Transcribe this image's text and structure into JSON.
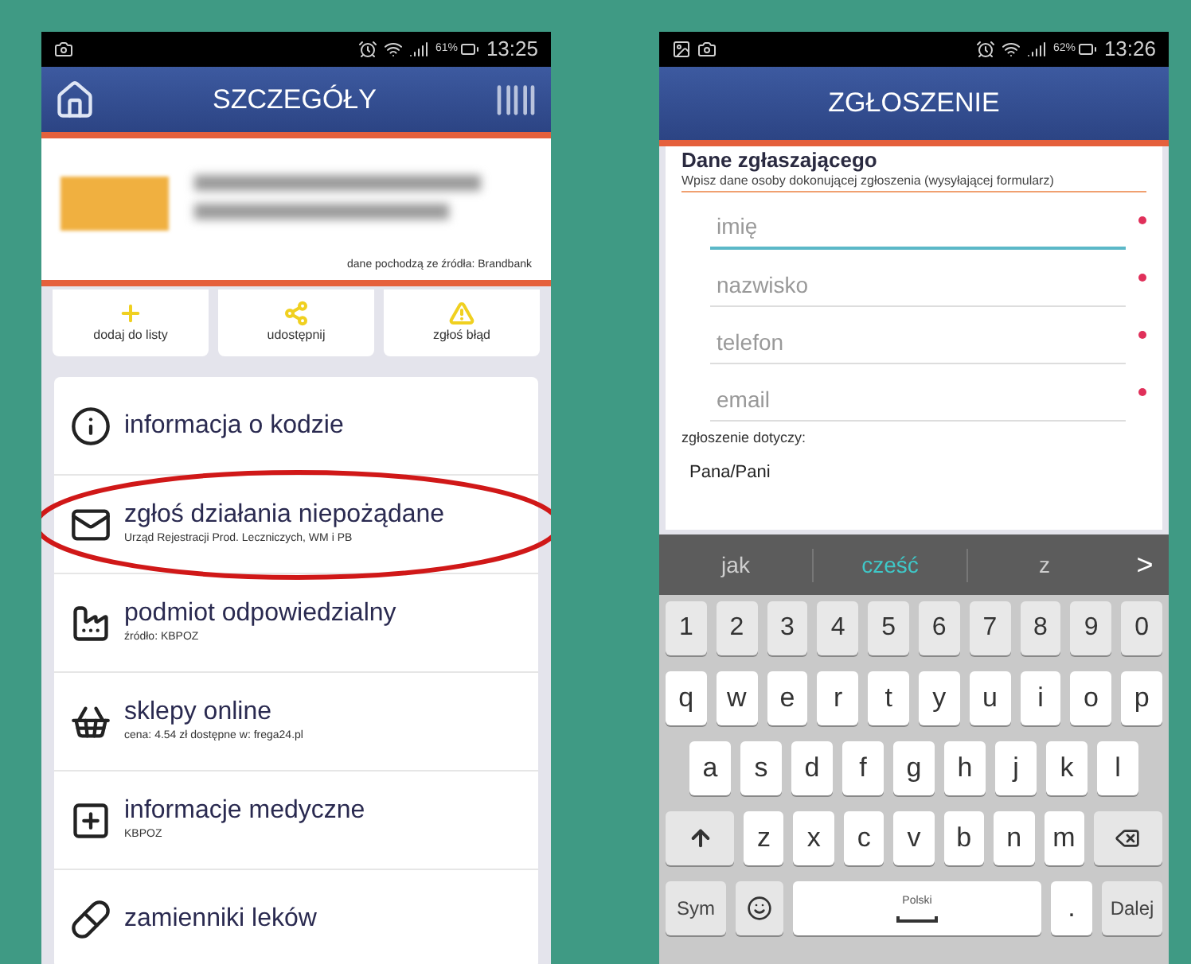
{
  "left_screen": {
    "status_bar": {
      "battery": "61%",
      "time": "13:25"
    },
    "header": {
      "title": "SZCZEGÓŁY"
    },
    "product": {
      "source": "dane pochodzą ze źródła: Brandbank"
    },
    "actions": [
      {
        "kind": "add",
        "label": "dodaj do listy"
      },
      {
        "kind": "share",
        "label": "udostępnij"
      },
      {
        "kind": "warning",
        "label": "zgłoś błąd"
      }
    ],
    "list": [
      {
        "kind": "info",
        "title": "informacja o kodzie",
        "highlighted": false
      },
      {
        "kind": "mail",
        "title": "zgłoś działania niepożądane",
        "subtitle": "Urząd Rejestracji Prod. Leczniczych, WM i PB",
        "highlighted": true
      },
      {
        "kind": "factory",
        "title": "podmiot odpowiedzialny",
        "subtitle": "źródło: KBPOZ",
        "highlighted": false
      },
      {
        "kind": "basket",
        "title": "sklepy online",
        "subtitle": "cena: 4.54 zł dostępne w: frega24.pl",
        "highlighted": false
      },
      {
        "kind": "medical",
        "title": "informacje medyczne",
        "subtitle": "KBPOZ",
        "highlighted": false
      },
      {
        "kind": "pill",
        "title": "zamienniki leków",
        "highlighted": false
      }
    ]
  },
  "right_screen": {
    "status_bar": {
      "battery": "62%",
      "time": "13:26"
    },
    "header": {
      "title": "ZGŁOSZENIE"
    },
    "form": {
      "section_title": "Dane zgłaszającego",
      "hint": "Wpisz dane osoby dokonującej zgłoszenia (wysyłającej formularz)",
      "fields": [
        {
          "placeholder": "imię",
          "focused": true,
          "required": true
        },
        {
          "placeholder": "nazwisko",
          "focused": false,
          "required": true
        },
        {
          "placeholder": "telefon",
          "focused": false,
          "required": true
        },
        {
          "placeholder": "email",
          "focused": false,
          "required": true
        }
      ],
      "subject_label": "zgłoszenie dotyczy:",
      "subject_value": "Pana/Pani"
    },
    "keyboard": {
      "suggestions": [
        {
          "text": "jak",
          "selected": false
        },
        {
          "text": "cześć",
          "selected": true
        },
        {
          "text": "z",
          "selected": false
        }
      ],
      "suggestion_arrow": ">",
      "rows": [
        {
          "keys": [
            {
              "kind": "num",
              "label": "1"
            },
            {
              "kind": "num",
              "label": "2"
            },
            {
              "kind": "num",
              "label": "3"
            },
            {
              "kind": "num",
              "label": "4"
            },
            {
              "kind": "num",
              "label": "5"
            },
            {
              "kind": "num",
              "label": "6"
            },
            {
              "kind": "num",
              "label": "7"
            },
            {
              "kind": "num",
              "label": "8"
            },
            {
              "kind": "num",
              "label": "9"
            },
            {
              "kind": "num",
              "label": "0"
            }
          ]
        },
        {
          "keys": [
            {
              "kind": "char",
              "label": "q"
            },
            {
              "kind": "char",
              "label": "w"
            },
            {
              "kind": "char",
              "label": "e"
            },
            {
              "kind": "char",
              "label": "r"
            },
            {
              "kind": "char",
              "label": "t"
            },
            {
              "kind": "char",
              "label": "y"
            },
            {
              "kind": "char",
              "label": "u"
            },
            {
              "kind": "char",
              "label": "i"
            },
            {
              "kind": "char",
              "label": "o"
            },
            {
              "kind": "char",
              "label": "p"
            }
          ]
        },
        {
          "keys": [
            {
              "kind": "char",
              "label": "a"
            },
            {
              "kind": "char",
              "label": "s"
            },
            {
              "kind": "char",
              "label": "d"
            },
            {
              "kind": "char",
              "label": "f"
            },
            {
              "kind": "char",
              "label": "g"
            },
            {
              "kind": "char",
              "label": "h"
            },
            {
              "kind": "char",
              "label": "j"
            },
            {
              "kind": "char",
              "label": "k"
            },
            {
              "kind": "char",
              "label": "l"
            }
          ]
        },
        {
          "keys": [
            {
              "kind": "shift"
            },
            {
              "kind": "char",
              "label": "z"
            },
            {
              "kind": "char",
              "label": "x"
            },
            {
              "kind": "char",
              "label": "c"
            },
            {
              "kind": "char",
              "label": "v"
            },
            {
              "kind": "char",
              "label": "b"
            },
            {
              "kind": "char",
              "label": "n"
            },
            {
              "kind": "char",
              "label": "m"
            },
            {
              "kind": "backspace"
            }
          ]
        },
        {
          "keys": [
            {
              "kind": "func",
              "label": "Sym"
            },
            {
              "kind": "emoji"
            },
            {
              "kind": "space",
              "label": "Polski"
            },
            {
              "kind": "char",
              "label": "."
            },
            {
              "kind": "func",
              "label": "Dalej"
            }
          ]
        }
      ]
    }
  }
}
